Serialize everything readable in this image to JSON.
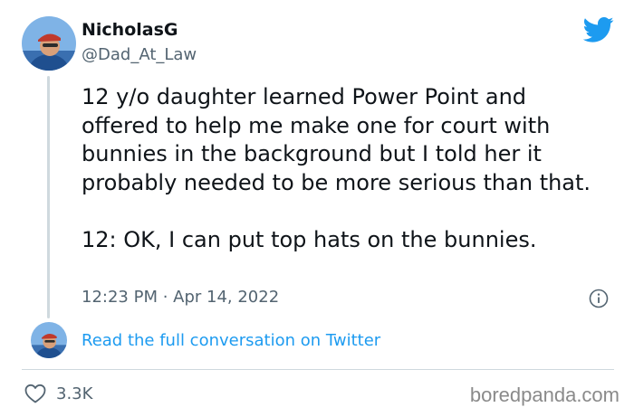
{
  "author": {
    "display_name": "NicholasG",
    "handle": "@Dad_At_Law",
    "avatar_icon": "user-avatar-icon"
  },
  "tweet": {
    "paragraphs": [
      "12 y/o daughter learned Power Point and offered to help me make one for court with bunnies in the background but I told her it probably needed to be more serious than that.",
      "12: OK, I can put top hats on the bunnies."
    ],
    "timestamp": "12:23 PM · Apr 14, 2022"
  },
  "conversation_link": "Read the full conversation on Twitter",
  "likes": "3.3K",
  "watermark": "boredpanda.com",
  "colors": {
    "twitter_blue": "#1d9bf0",
    "text_primary": "#0f1419",
    "text_secondary": "#536471",
    "divider": "#cfd9de"
  },
  "icons": {
    "brand": "twitter-bird-icon",
    "info": "info-icon",
    "like": "heart-icon"
  }
}
